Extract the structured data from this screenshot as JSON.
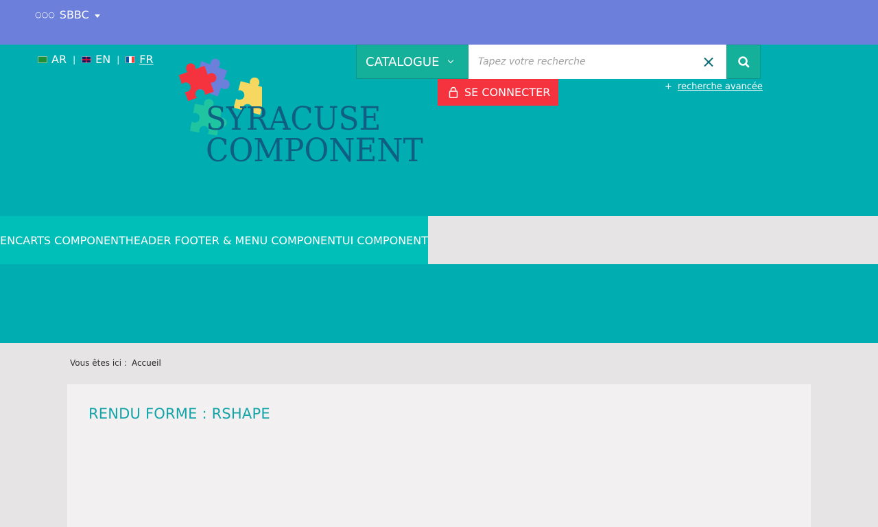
{
  "topbar": {
    "site_label": "SBBC",
    "site_icon": "dots-icon"
  },
  "languages": [
    {
      "code": "AR",
      "flag": "flag-ar-icon"
    },
    {
      "code": "EN",
      "flag": "flag-en-icon"
    },
    {
      "code": "FR",
      "flag": "flag-fr-icon",
      "active": true
    }
  ],
  "logo": {
    "line1": "SYRACUSE",
    "line2": "COMPONENT"
  },
  "search": {
    "catalogue_label": "CATALOGUE",
    "placeholder": "Tapez votre recherche",
    "value": "",
    "advanced_label": "recherche avancée",
    "advanced_prefix": "+"
  },
  "login": {
    "label": "SE CONNECTER"
  },
  "nav": {
    "items": [
      "ENCARTS COMPONENT",
      "HEADER FOOTER & MENU COMPONENT",
      "UI COMPONENT"
    ]
  },
  "breadcrumb": {
    "prefix": "Vous êtes ici :",
    "home": "Accueil"
  },
  "content": {
    "title": "RENDU FORME : RSHAPE"
  },
  "colors": {
    "topbar": "#6b7fdb",
    "header": "#00aeb2",
    "nav": "#00bfb9",
    "accent_green": "#14b09a",
    "login_red": "#f4333f",
    "title": "#14a3a8",
    "logo_text": "#0e5f82"
  }
}
